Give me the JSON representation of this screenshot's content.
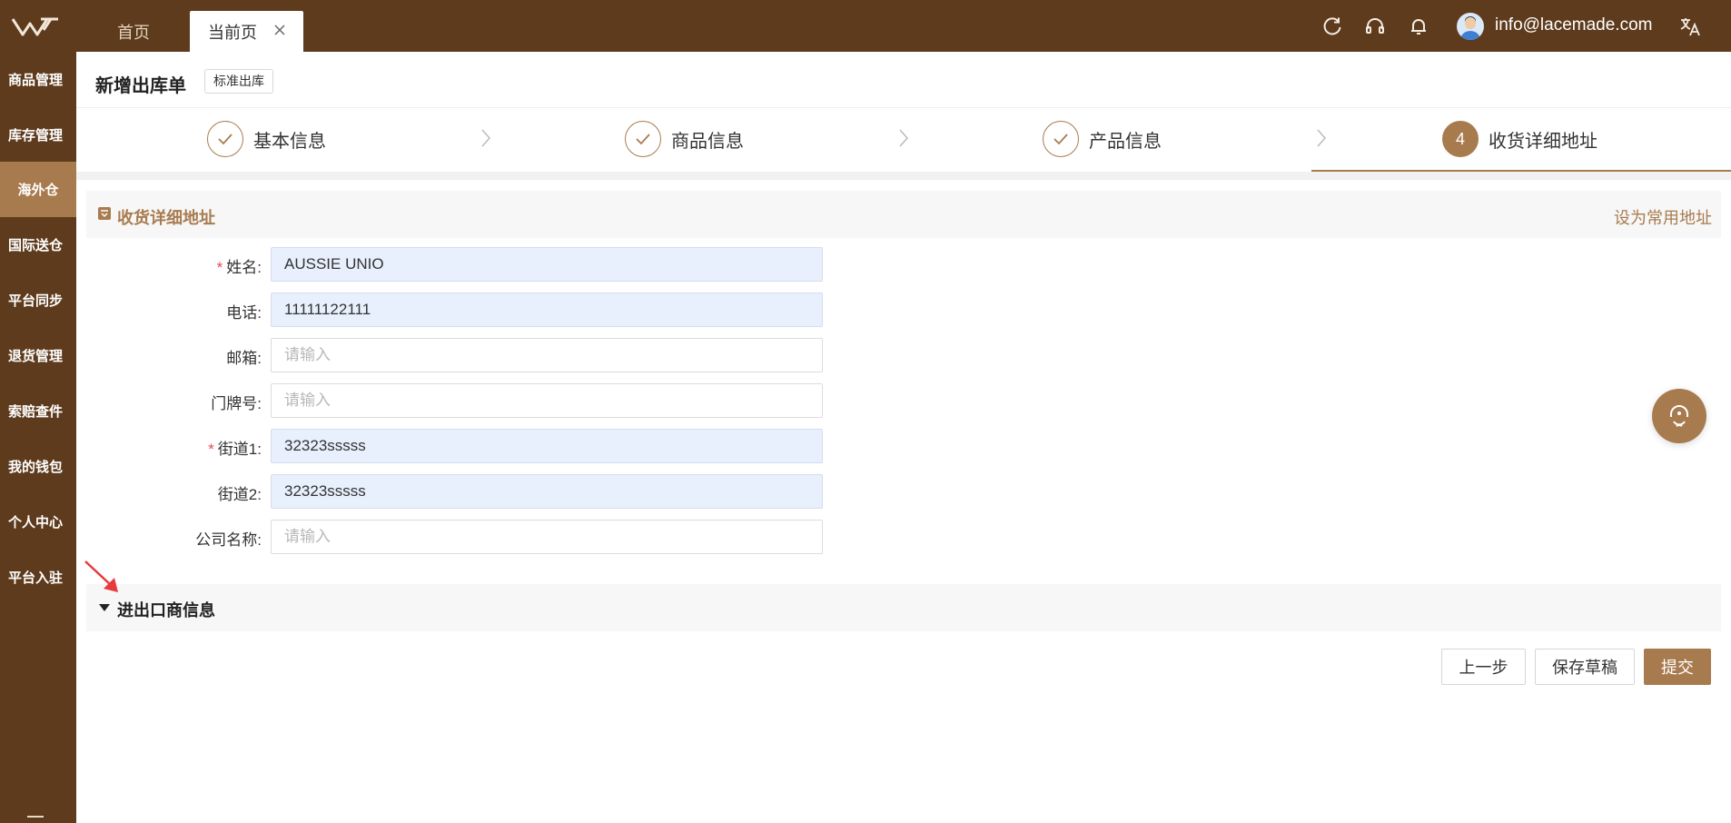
{
  "topbar": {
    "tabs": [
      {
        "label": "首页"
      },
      {
        "label": "当前页"
      }
    ],
    "user_email": "info@lacemade.com"
  },
  "sidebar": {
    "items": [
      {
        "label": "商品管理"
      },
      {
        "label": "库存管理"
      },
      {
        "label": "海外仓",
        "active": true
      },
      {
        "label": "国际送仓"
      },
      {
        "label": "平台同步"
      },
      {
        "label": "退货管理"
      },
      {
        "label": "索赔查件"
      },
      {
        "label": "我的钱包"
      },
      {
        "label": "个人中心"
      },
      {
        "label": "平台入驻"
      }
    ]
  },
  "header": {
    "title": "新增出库单",
    "tag": "标准出库"
  },
  "steps": [
    {
      "label": "基本信息",
      "status": "done"
    },
    {
      "label": "商品信息",
      "status": "done"
    },
    {
      "label": "产品信息",
      "status": "done"
    },
    {
      "number": "4",
      "label": "收货详细地址",
      "status": "active"
    }
  ],
  "section": {
    "title": "收货详细地址",
    "link": "设为常用地址"
  },
  "form": {
    "fields": [
      {
        "label": "姓名:",
        "required": true,
        "value": "AUSSIE UNIO",
        "placeholder": "请输入"
      },
      {
        "label": "电话:",
        "required": false,
        "value": "11111122111",
        "placeholder": "请输入"
      },
      {
        "label": "邮箱:",
        "required": false,
        "value": "",
        "placeholder": "请输入"
      },
      {
        "label": "门牌号:",
        "required": false,
        "value": "",
        "placeholder": "请输入"
      },
      {
        "label": "街道1:",
        "required": true,
        "value": "32323sssss",
        "placeholder": "请输入"
      },
      {
        "label": "街道2:",
        "required": false,
        "value": "32323sssss",
        "placeholder": "请输入"
      },
      {
        "label": "公司名称:",
        "required": false,
        "value": "",
        "placeholder": "请输入"
      }
    ]
  },
  "collapse": {
    "title": "进出口商信息"
  },
  "buttons": {
    "prev": "上一步",
    "draft": "保存草稿",
    "submit": "提交"
  },
  "colors": {
    "brand_dark": "#5e3b1d",
    "accent": "#a87b4f",
    "filled_input": "#e8f0fd",
    "required": "#e84b4b"
  },
  "icons": {
    "logo": "logo-w-icon",
    "refresh": "refresh-icon",
    "support": "headset-icon",
    "notifications": "bell-icon",
    "language": "translate-icon",
    "section": "address-card-icon",
    "float": "customer-service-icon"
  }
}
